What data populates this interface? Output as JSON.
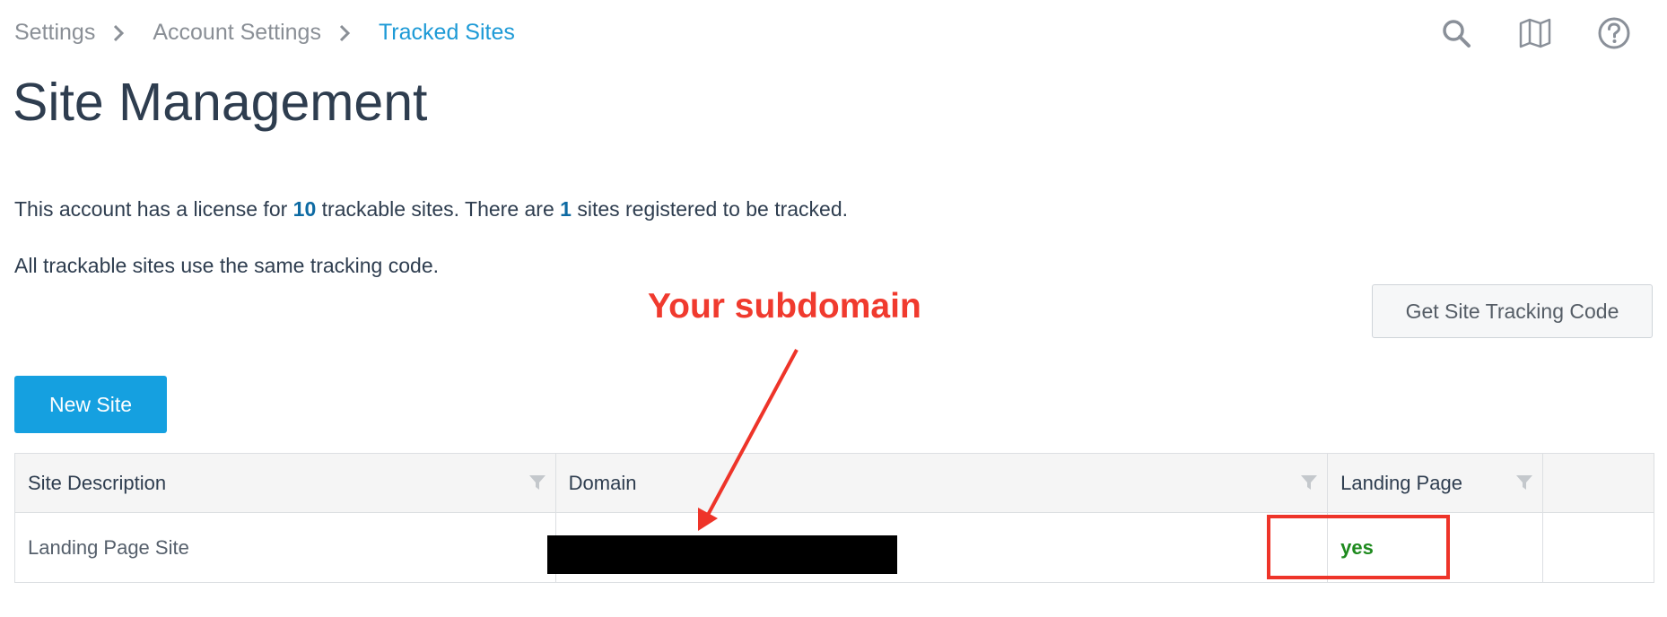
{
  "breadcrumb": {
    "items": [
      "Settings",
      "Account Settings",
      "Tracked Sites"
    ]
  },
  "header_icons": [
    "search-icon",
    "map-icon",
    "help-icon"
  ],
  "page": {
    "title": "Site Management",
    "license": {
      "prefix": "This account has a license for",
      "licensed_count": "10",
      "middle": "trackable sites. There are",
      "registered_count": "1",
      "suffix": "sites registered to be tracked."
    },
    "same_code_note": "All trackable sites use the same tracking code.",
    "get_code_button": "Get Site Tracking Code",
    "new_site_button": "New Site"
  },
  "annotation": {
    "label": "Your subdomain",
    "color": "#f03a2e"
  },
  "table": {
    "columns": [
      "Site Description",
      "Domain",
      "Landing Page",
      ""
    ],
    "rows": [
      {
        "description": "Landing Page Site",
        "domain": "",
        "landing_page": "yes"
      }
    ]
  },
  "colors": {
    "accent": "#1d9ad6",
    "primary_button": "#15a0e0",
    "yes": "#1e8a1e",
    "highlight": "#ee3429"
  }
}
